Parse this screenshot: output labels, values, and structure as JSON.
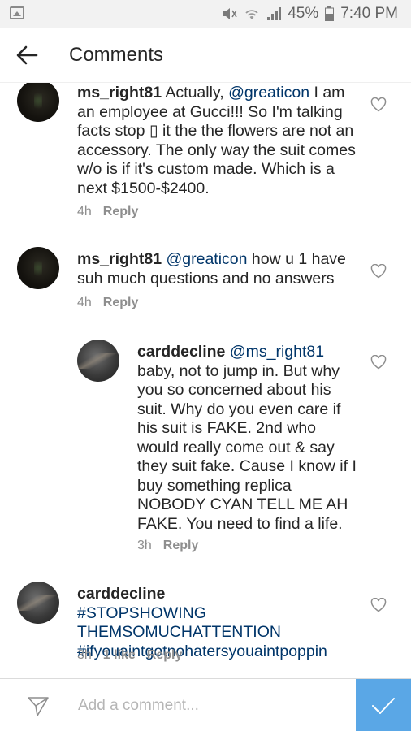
{
  "status_bar": {
    "battery": "45%",
    "time": "7:40 PM"
  },
  "header": {
    "title": "Comments"
  },
  "comments": [
    {
      "username": "ms_right81",
      "text_before": " Actually, ",
      "mention": "@greaticon",
      "text_after": " I am an employee at Gucci!!! So I'm talking facts stop ▯ it the the flowers are not an accessory. The only way the suit comes w/o is if it's custom made. Which is a next $1500-$2400.",
      "time": "4h",
      "reply_label": "Reply"
    },
    {
      "username": "ms_right81",
      "text_before": " ",
      "mention": "@greaticon",
      "text_after": " how u 1 have suh much questions and no answers",
      "time": "4h",
      "reply_label": "Reply"
    },
    {
      "username": "carddecline",
      "text_before": " ",
      "mention": "@ms_right81",
      "text_after": " baby, not to jump in. But why you so concerned about his suit. Why do you even care if his suit is FAKE. 2nd who would really come out & say they suit fake. Cause I know if I buy something replica NOBODY CYAN TELL ME AH FAKE. You need to find a life.",
      "time": "3h",
      "reply_label": "Reply"
    },
    {
      "username": "carddecline",
      "hashtag_1": "#STOPSHOWING THEMSOMUCHATTENTION",
      "hashtag_2": "#ifyouaintgotnohatersyouaintpoppin",
      "time": "3h",
      "likes": "1 like",
      "reply_label": "Reply"
    }
  ],
  "composer": {
    "placeholder": "Add a comment..."
  },
  "colors": {
    "mention": "#003569",
    "post_button": "#5aa7e6"
  }
}
